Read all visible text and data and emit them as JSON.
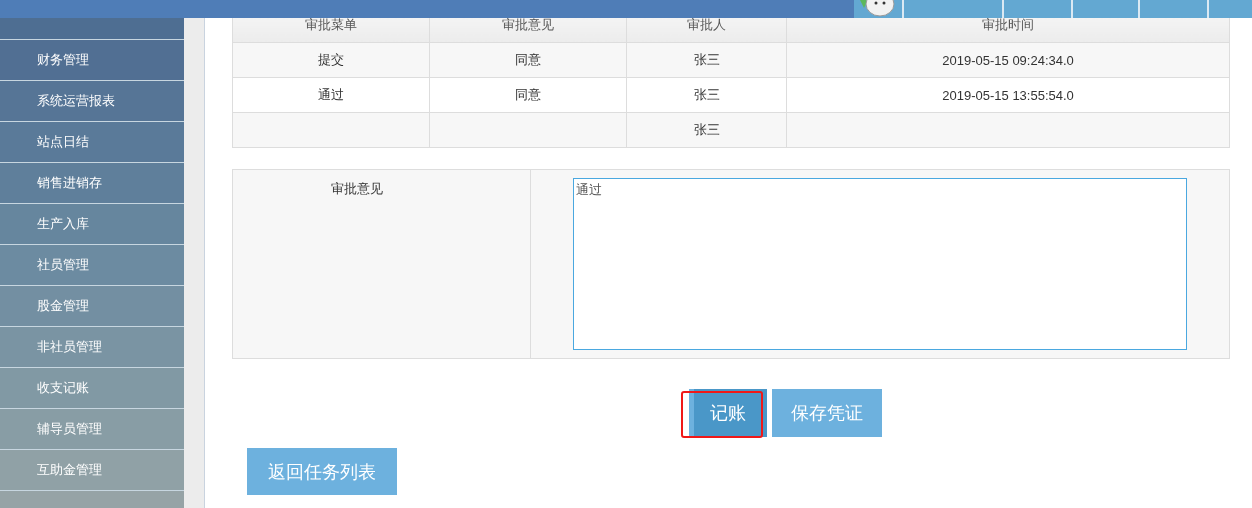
{
  "sidebar": {
    "items": [
      {
        "label": "财务管理"
      },
      {
        "label": "系统运营报表"
      },
      {
        "label": "站点日结"
      },
      {
        "label": "销售进销存"
      },
      {
        "label": "生产入库"
      },
      {
        "label": "社员管理"
      },
      {
        "label": "股金管理"
      },
      {
        "label": "非社员管理"
      },
      {
        "label": "收支记账"
      },
      {
        "label": "辅导员管理"
      },
      {
        "label": "互助金管理"
      }
    ]
  },
  "approval_table": {
    "columns": [
      "审批菜单",
      "审批意见",
      "审批人",
      "审批时间"
    ],
    "rows": [
      [
        "提交",
        "同意",
        "张三",
        "2019-05-15 09:24:34.0"
      ],
      [
        "通过",
        "同意",
        "张三",
        "2019-05-15 13:55:54.0"
      ],
      [
        "",
        "",
        "张三",
        ""
      ]
    ]
  },
  "opinion_form": {
    "label": "审批意见",
    "value": "通过"
  },
  "buttons": [
    {
      "label": "记账",
      "highlighted": true
    },
    {
      "label": "保存凭证",
      "highlighted": false
    }
  ],
  "back_button": {
    "label": "返回任务列表"
  }
}
